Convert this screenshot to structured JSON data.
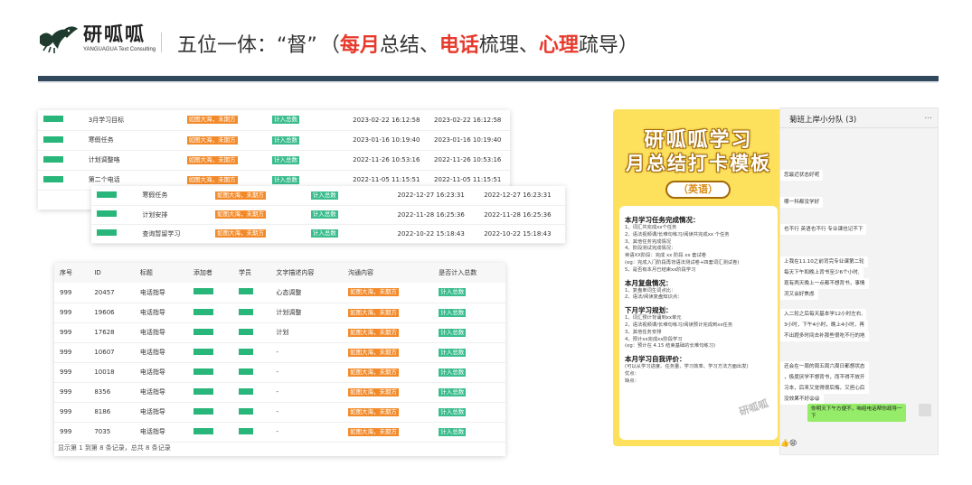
{
  "header": {
    "logo_cn": "研呱呱",
    "logo_en": "YANGUAGUA Text Consulting",
    "title_prefix": "五位一体：",
    "quote": "“督”",
    "paren_open": "（",
    "seg1": "每月",
    "seg2": "总结、",
    "seg3": "电话",
    "seg4": "梳理、",
    "seg5": "心理",
    "seg6": "疏导）"
  },
  "panel1": {
    "rows": [
      {
        "title": "3月学习目标",
        "tag1": "如图大海，未期方",
        "tag2": "计入总数",
        "t1": "2023-02-22 16:12:58",
        "t2": "2023-02-22 16:12:58"
      },
      {
        "title": "寒假任务",
        "tag1": "如图大海，未期方",
        "tag2": "计入总数",
        "t1": "2023-01-16 10:19:40",
        "t2": "2023-01-16 10:19:40"
      },
      {
        "title": "计划调整咯",
        "tag1": "如图大海，未期方",
        "tag2": "计入总数",
        "t1": "2022-11-26 10:53:16",
        "t2": "2022-11-26 10:53:16"
      },
      {
        "title": "第二个电话",
        "tag1": "如图大海，未期方",
        "tag2": "计入总数",
        "t1": "2022-11-05 11:15:51",
        "t2": "2022-11-05 11:15:51"
      }
    ]
  },
  "panel2": {
    "rows": [
      {
        "title": "寒假任务",
        "tag1": "如图大海，未期方",
        "tag2": "计入总数",
        "t1": "2022-12-27 16:23:31",
        "t2": "2022-12-27 16:23:31"
      },
      {
        "title": "计划安排",
        "tag1": "如图大海，未期方",
        "tag2": "计入总数",
        "t1": "2022-11-28 16:25:36",
        "t2": "2022-11-28 16:25:36"
      },
      {
        "title": "查询暂留学习",
        "tag1": "如图大海，未期方",
        "tag2": "计入总数",
        "t1": "2022-10-22 15:18:43",
        "t2": "2022-10-22 15:18:43"
      }
    ]
  },
  "panel3": {
    "headers": [
      "序号",
      "ID",
      "标题",
      "添加者",
      "学员",
      "文字描述内容",
      "沟通内容",
      "是否计入总数"
    ],
    "rows": [
      {
        "no": "999",
        "id": "20457",
        "title": "电话指导",
        "desc": "心态调整",
        "tag1": "如图大海，未期方",
        "tag2": "计入总数"
      },
      {
        "no": "999",
        "id": "19606",
        "title": "电话指导",
        "desc": "计划调整",
        "tag1": "如图大海，未期方",
        "tag2": "计入总数"
      },
      {
        "no": "999",
        "id": "17628",
        "title": "电话指导",
        "desc": "计划",
        "tag1": "如图大海，未期方",
        "tag2": "计入总数"
      },
      {
        "no": "999",
        "id": "10607",
        "title": "电话指导",
        "desc": "-",
        "tag1": "如图大海，未期方",
        "tag2": "计入总数"
      },
      {
        "no": "999",
        "id": "10018",
        "title": "电话指导",
        "desc": "-",
        "tag1": "如图大海，未期方",
        "tag2": "计入总数"
      },
      {
        "no": "999",
        "id": "8356",
        "title": "电话指导",
        "desc": "-",
        "tag1": "如图大海，未期方",
        "tag2": "计入总数"
      },
      {
        "no": "999",
        "id": "8186",
        "title": "电话指导",
        "desc": "-",
        "tag1": "如图大海，未期方",
        "tag2": "计入总数"
      },
      {
        "no": "999",
        "id": "7035",
        "title": "电话指导",
        "desc": "-",
        "tag1": "如图大海，未期方",
        "tag2": "计入总数"
      }
    ],
    "footer": "显示第 1 到第 8 条记录，总共 8 条记录"
  },
  "poster": {
    "title1": "研呱呱学习",
    "title2": "月总结打卡模板",
    "tag": "（英语）",
    "watermark": "研呱呱",
    "sections": [
      {
        "h": "本月学习任务完成情况：",
        "lines": [
          "1、词汇共完成xx个任务",
          "2、语法视频课/长难句练习/阅读共完成xx 个任务",
          "3、其他任务完成情况",
          "4、阶段测试完成情况：",
          "英语XX阶段：完成 xx 阶段 xx 套试卷",
          "(eg：完成入门阶段再背语法测试卷+四套词汇测试卷)",
          "5、是否有本月已结束xx阶段学习"
        ]
      },
      {
        "h": "本月复盘情况：",
        "lines": [
          "1、复盘单词生词点比：",
          "2、语法/阅读复盘知识点："
        ]
      },
      {
        "h": "下月学习规划：",
        "lines": [
          "1、词汇预计背诵到xx单元",
          "2、语法视频课/长难句练习/阅读预计完成到xx任务",
          "3、其他任务安排",
          "4、预计xx完成xx阶段学习",
          "(eg：预计在 4.15 结束基础的长难句练习)"
        ]
      },
      {
        "h": "本月学习自我评价：",
        "lines": [
          "(可以从学习进度、任务量、学习效率、学习方法方面出发)",
          "优点：",
          "缺点："
        ]
      }
    ]
  },
  "chat": {
    "title": "菊班上岸小分队 (3)",
    "dots": "...",
    "messages": [
      "您最近状态好呢",
      "哪一科都没学好",
      "也不行 英语也不行 专业课也记不下",
      "",
      "上我在11.10之前背完专业课第二轮",
      "每天下午和晚上背书至少6个小时,",
      "现有两天晚上一点都不想背书，事情",
      "况又会好焦虑",
      "入二轮之后每天基本学12小时左右,",
      "3小时，下午4小时，晚上4小时，再",
      "不出题多时间去补那些很吃不行的地",
      "还会在一周的周五周六周日都想状态",
      "，极度厌学不想背书，而不得不放开",
      "习本，后来又觉得很后悔，又担心后",
      "没效果不好😫😫"
    ],
    "my_msg_1": "你明天下午方便不，咱组电话帮你疏导一",
    "my_msg_2": "下",
    "emoji": "👍😫"
  }
}
